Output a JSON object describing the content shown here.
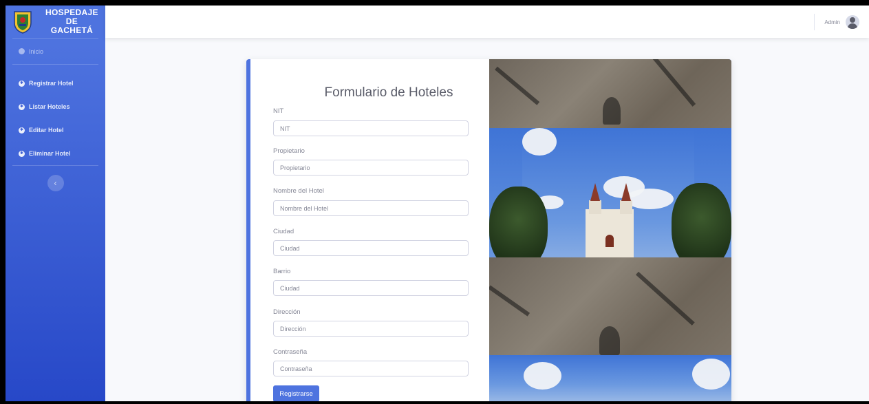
{
  "brand": {
    "line1": "HOSPEDAJE DE",
    "line2": "GACHETÁ"
  },
  "sidebar": {
    "items": [
      {
        "label": "Inicio"
      },
      {
        "label": "Registrar Hotel"
      },
      {
        "label": "Listar Hoteles"
      },
      {
        "label": "Editar Hotel"
      },
      {
        "label": "Eliminar Hotel"
      }
    ],
    "toggle_icon": "chevron-left-icon"
  },
  "topbar": {
    "user_name": "Admin",
    "avatar_icon": "user-avatar-icon"
  },
  "form": {
    "title": "Formulario de Hoteles",
    "fields": [
      {
        "label": "NIT",
        "placeholder": "NIT",
        "value": ""
      },
      {
        "label": "Propietario",
        "placeholder": "Propietario",
        "value": ""
      },
      {
        "label": "Nombre del Hotel",
        "placeholder": "Nombre del Hotel",
        "value": ""
      },
      {
        "label": "Ciudad",
        "placeholder": "Ciudad",
        "value": ""
      },
      {
        "label": "Barrio",
        "placeholder": "Ciudad",
        "value": ""
      },
      {
        "label": "Dirección",
        "placeholder": "Dirección",
        "value": ""
      },
      {
        "label": "Contraseña",
        "placeholder": "Contraseña",
        "value": ""
      }
    ],
    "submit_label": "Registrarse"
  },
  "colors": {
    "primary": "#4e73df",
    "sidebar_dark": "#2748c8",
    "background": "#f8f9fc"
  }
}
